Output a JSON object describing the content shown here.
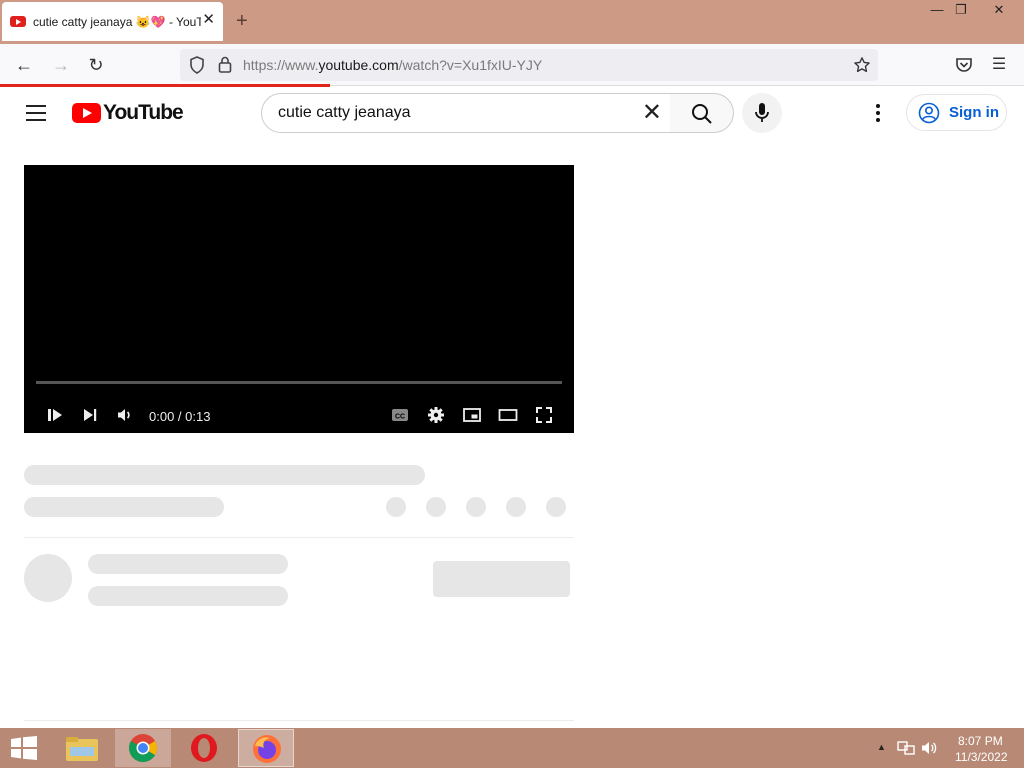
{
  "browser": {
    "tab_title": "cutie catty jeanaya 😺💖 - YouTube",
    "url_prefix": "https://www.",
    "url_domain": "youtube.com",
    "url_path": "/watch?v=Xu1fxIU-YJY",
    "accent": "#e1251b"
  },
  "youtube": {
    "logo_text": "YouTube",
    "search_query": "cutie catty jeanaya",
    "signin_label": "Sign in"
  },
  "player": {
    "time_display": "0:00 / 0:13",
    "progress_fraction": 0
  },
  "taskbar": {
    "clock_time": "8:07 PM",
    "clock_date": "11/3/2022",
    "apps": [
      "windows-start",
      "file-explorer",
      "chrome",
      "opera",
      "firefox"
    ]
  },
  "icons": [
    "menu-icon",
    "search-icon",
    "mic-icon",
    "more-vert-icon",
    "account-icon",
    "play-icon",
    "next-icon",
    "volume-icon",
    "cc-icon",
    "settings-icon",
    "miniplayer-icon",
    "theater-icon",
    "fullscreen-icon"
  ]
}
